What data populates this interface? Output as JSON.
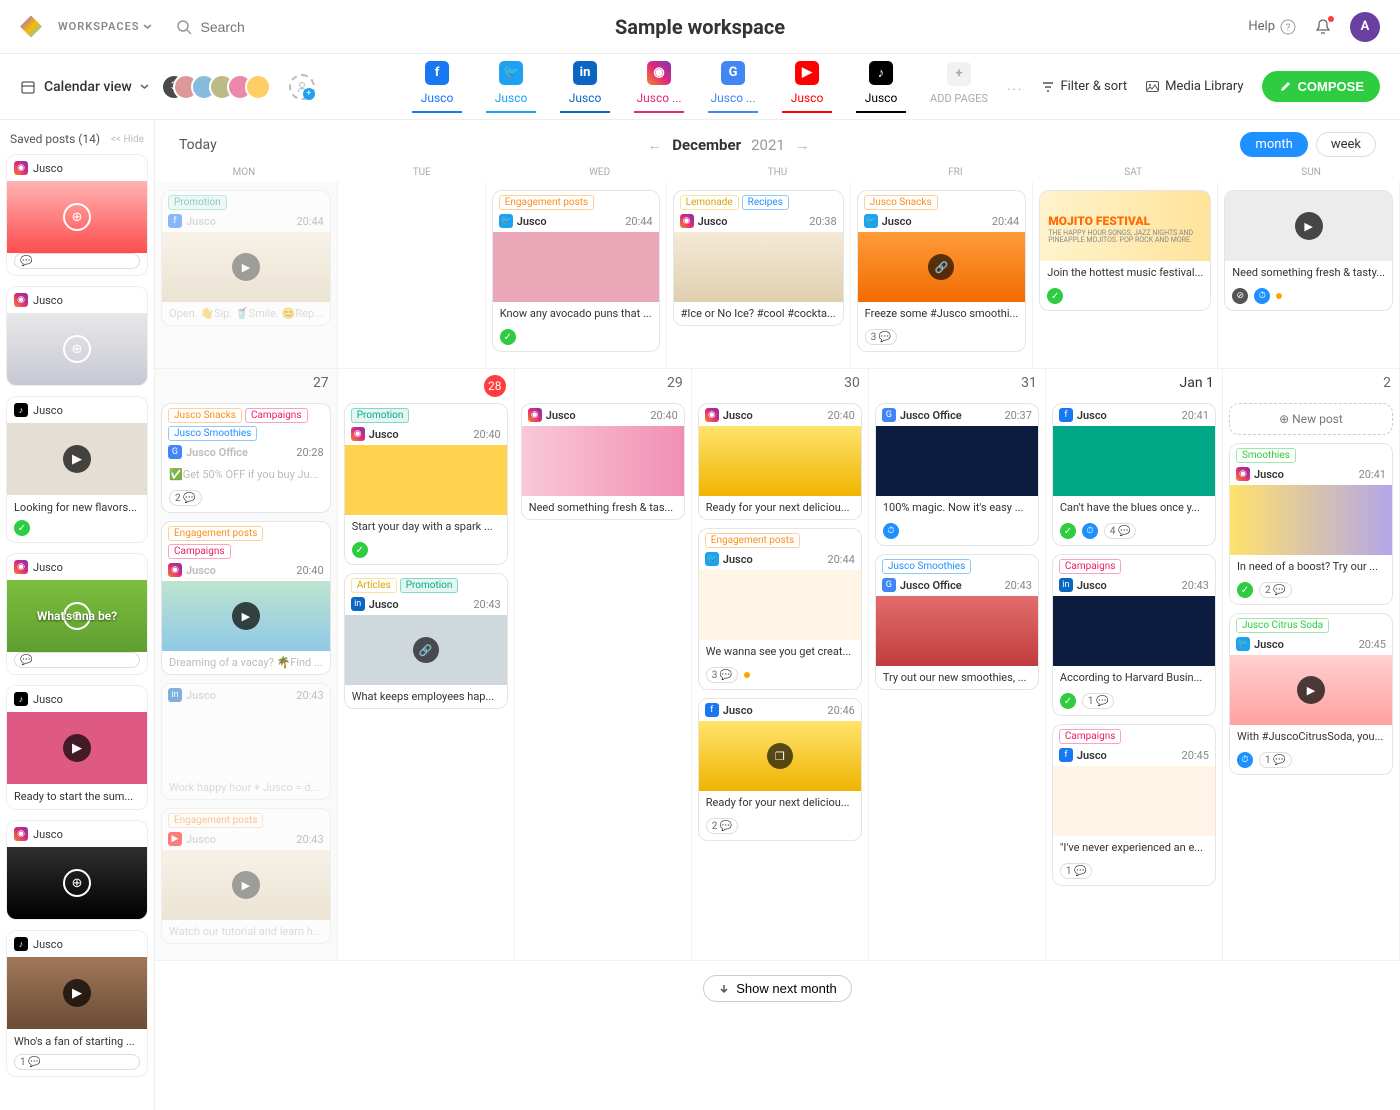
{
  "top": {
    "workspaces_label": "WORKSPACES",
    "search_placeholder": "Search",
    "title": "Sample workspace",
    "help": "Help",
    "avatar_letter": "A"
  },
  "sub": {
    "view_label": "Calendar view",
    "avatar_count": "3",
    "more": "...",
    "filter": "Filter & sort",
    "media": "Media Library",
    "compose": "COMPOSE"
  },
  "pages": [
    {
      "label": "Jusco",
      "type": "fb",
      "active": true
    },
    {
      "label": "Jusco",
      "type": "tw",
      "active": true
    },
    {
      "label": "Jusco",
      "type": "li",
      "active": true
    },
    {
      "label": "Jusco ...",
      "type": "ig",
      "active": true
    },
    {
      "label": "Jusco ...",
      "type": "gmb",
      "active": true
    },
    {
      "label": "Jusco",
      "type": "yt",
      "active": true
    },
    {
      "label": "Jusco",
      "type": "tt",
      "active": true
    }
  ],
  "add_pages": "ADD PAGES",
  "saved": {
    "title": "Saved posts (14)",
    "hide": "<< Hide",
    "items": [
      {
        "platform": "ig",
        "acct": "Jusco",
        "img": "strawberry",
        "overlay": "ring",
        "caption": "",
        "foot_cmt": true
      },
      {
        "platform": "ig",
        "acct": "Jusco",
        "img": "berries",
        "overlay": "ring",
        "caption": ""
      },
      {
        "platform": "tt",
        "acct": "Jusco",
        "img": "neutral",
        "overlay": "play",
        "caption": "Looking for new flavors...",
        "foot_ok": true
      },
      {
        "platform": "ig",
        "acct": "Jusco",
        "img": "limes",
        "overlay": "ring",
        "overlay_text": "What's   nna be?",
        "caption": "",
        "foot_cmt": true
      },
      {
        "platform": "tt",
        "acct": "Jusco",
        "img": "pink",
        "overlay": "play",
        "caption": "Ready to start the sum..."
      },
      {
        "platform": "ig",
        "acct": "Jusco",
        "img": "detox",
        "overlay": "ring",
        "caption": ""
      },
      {
        "platform": "tt",
        "acct": "Jusco",
        "img": "wood",
        "overlay": "play",
        "caption": "Who's a fan of starting ...",
        "foot_cmt1": true
      }
    ]
  },
  "cal": {
    "today": "Today",
    "month": "December",
    "year": "2021",
    "month_pill": "month",
    "week_pill": "week",
    "dow": [
      "MON",
      "TUE",
      "WED",
      "THU",
      "FRI",
      "SAT",
      "SUN"
    ],
    "new_post": "New post",
    "show_next": "Show next month"
  },
  "week1": {
    "mon": {
      "card": {
        "tags": [
          {
            "t": "Promotion",
            "c": "t-teal"
          }
        ],
        "plat": "fb",
        "acct": "Jusco",
        "time": "20:44",
        "img": "drinks",
        "overlay": "play",
        "text": "Open. 👋Sip. 🥤Smile. 😊Rep...",
        "faded": true
      }
    },
    "wed": {
      "card": {
        "tags": [
          {
            "t": "Engagement posts",
            "c": "t-orange"
          }
        ],
        "plat": "tw",
        "acct": "Jusco",
        "time": "20:44",
        "img": "pinkavo",
        "text": "Know any avocado puns that ...",
        "foot": {
          "ok": true
        }
      }
    },
    "thu": {
      "card": {
        "tags": [
          {
            "t": "Lemonade",
            "c": "t-yellow"
          },
          {
            "t": "Recipes",
            "c": "t-blue"
          }
        ],
        "plat": "ig",
        "acct": "Jusco",
        "time": "20:38",
        "img": "drinks",
        "text": "#Ice or No Ice? #cool #cockta..."
      }
    },
    "fri": {
      "card": {
        "tags": [
          {
            "t": "Jusco Snacks",
            "c": "t-orange"
          }
        ],
        "plat": "tw",
        "acct": "Jusco",
        "time": "20:44",
        "img": "orange",
        "overlay": "link",
        "text": "Freeze some #Jusco smoothi...",
        "foot": {
          "cmt": "3"
        }
      }
    },
    "sat": {
      "card": {
        "img": "mojito",
        "mojito": "MOJITO FESTIVAL",
        "mojito_sub": "THE HAPPY HOUR SONGS, JAZZ NIGHTS AND PINEAPPLE MOJITOS. POP ROCK AND MORE.",
        "text": "Join the hottest music festival...",
        "foot": {
          "ok": true
        }
      }
    },
    "sun": {
      "card": {
        "img": "studio",
        "overlay": "play",
        "text": "Need something fresh & tasty...",
        "foot": {
          "eye": true,
          "clock": true,
          "dot": true
        }
      }
    }
  },
  "row2_days": {
    "mon": "27",
    "tue": "28",
    "wed": "29",
    "thu": "30",
    "fri": "31",
    "sat": "Jan 1",
    "sun": "2"
  },
  "row2": {
    "mon": [
      {
        "tags": [
          {
            "t": "Jusco Snacks",
            "c": "t-orange"
          },
          {
            "t": "Campaigns",
            "c": "t-pink"
          },
          {
            "t": "Jusco Smoothies",
            "c": "t-blue"
          }
        ],
        "plat": "gmb",
        "acct": "Jusco Office",
        "time": "20:28",
        "text": "✅Get 50% OFF if you buy Ju...",
        "foot": {
          "cmt": "2"
        },
        "noimg": true
      },
      {
        "tags": [
          {
            "t": "Engagement posts",
            "c": "t-orange"
          },
          {
            "t": "Campaigns",
            "c": "t-pink"
          }
        ],
        "plat": "ig",
        "acct": "Jusco",
        "time": "20:40",
        "img": "beach",
        "overlay": "play",
        "text": "Dreaming of a vacay? 🌴Find ..."
      },
      {
        "plat": "li",
        "acct": "Jusco",
        "time": "20:43",
        "img": "caps",
        "text": "Work happy hour + Jusco = d...",
        "faded": true
      },
      {
        "tags": [
          {
            "t": "Engagement posts",
            "c": "t-orange"
          }
        ],
        "plat": "yt",
        "acct": "Jusco",
        "time": "20:43",
        "img": "drinks",
        "overlay": "play",
        "text": "Watch our tutorial and learn h...",
        "faded": true
      }
    ],
    "tue": [
      {
        "tags": [
          {
            "t": "Promotion",
            "c": "t-teal"
          }
        ],
        "plat": "ig",
        "acct": "Jusco",
        "time": "20:40",
        "img": "yellow",
        "text": "Start your day with a spark ...",
        "foot": {
          "ok": true
        }
      },
      {
        "tags": [
          {
            "t": "Articles",
            "c": "t-yellow"
          },
          {
            "t": "Promotion",
            "c": "t-teal"
          }
        ],
        "plat": "li",
        "acct": "Jusco",
        "time": "20:43",
        "img": "office",
        "overlay": "link",
        "text": "What keeps employees hap..."
      }
    ],
    "wed": [
      {
        "plat": "ig",
        "acct": "Jusco",
        "time": "20:40",
        "img": "pinkwave",
        "text": "Need something fresh & tas..."
      }
    ],
    "thu": [
      {
        "plat": "ig",
        "acct": "Jusco",
        "time": "20:40",
        "img": "pineapple",
        "text": "Ready for your next deliciou..."
      },
      {
        "tags": [
          {
            "t": "Engagement posts",
            "c": "t-orange"
          }
        ],
        "plat": "tw",
        "acct": "Jusco",
        "time": "20:44",
        "img": "cream",
        "text": "We wanna see you get creat...",
        "foot": {
          "cmt": "3",
          "dot": true
        }
      },
      {
        "plat": "fb",
        "acct": "Jusco",
        "time": "20:46",
        "img": "pineapple",
        "overlay": "multi",
        "text": "Ready for your next deliciou...",
        "foot": {
          "cmt": "2"
        }
      }
    ],
    "fri": [
      {
        "plat": "gmb",
        "acct": "Jusco Office",
        "time": "20:37",
        "img": "darkblue",
        "text": "100% magic. Now it's easy ...",
        "foot": {
          "clock": true
        }
      },
      {
        "tags": [
          {
            "t": "Jusco Smoothies",
            "c": "t-blue"
          }
        ],
        "plat": "gmb",
        "acct": "Jusco Office",
        "time": "20:43",
        "img": "redbox",
        "text": "Try out our new smoothies, ..."
      }
    ],
    "sat": [
      {
        "plat": "fb",
        "acct": "Jusco",
        "time": "20:41",
        "img": "tealbg",
        "text": "Can't have the blues once y...",
        "foot": {
          "ok": true,
          "clock": true,
          "cmt": "4"
        }
      },
      {
        "tags": [
          {
            "t": "Campaigns",
            "c": "t-pink"
          }
        ],
        "plat": "li",
        "acct": "Jusco",
        "time": "20:43",
        "img": "darkblue",
        "text": "According to Harvard Busin...",
        "foot": {
          "ok": true,
          "cmt": "1"
        }
      },
      {
        "tags": [
          {
            "t": "Campaigns",
            "c": "t-pink"
          }
        ],
        "plat": "fb",
        "acct": "Jusco",
        "time": "20:45",
        "img": "cream",
        "text": "\"I've never experienced an e...",
        "foot": {
          "cmt": "1"
        }
      }
    ],
    "sun": [
      {
        "tags": [
          {
            "t": "Smoothies",
            "c": "t-green"
          }
        ],
        "plat": "ig",
        "acct": "Jusco",
        "time": "20:41",
        "img": "purplebottle",
        "text": "In need of a boost? Try our ...",
        "foot": {
          "ok": true,
          "cmt": "2"
        }
      },
      {
        "tags": [
          {
            "t": "Jusco Citrus Soda",
            "c": "t-green"
          }
        ],
        "plat": "tw",
        "acct": "Jusco",
        "time": "20:45",
        "img": "strawsoda",
        "overlay": "play",
        "text": "With #JuscoCitrusSoda, you...",
        "foot": {
          "clock": true,
          "cmt": "1"
        }
      }
    ]
  }
}
